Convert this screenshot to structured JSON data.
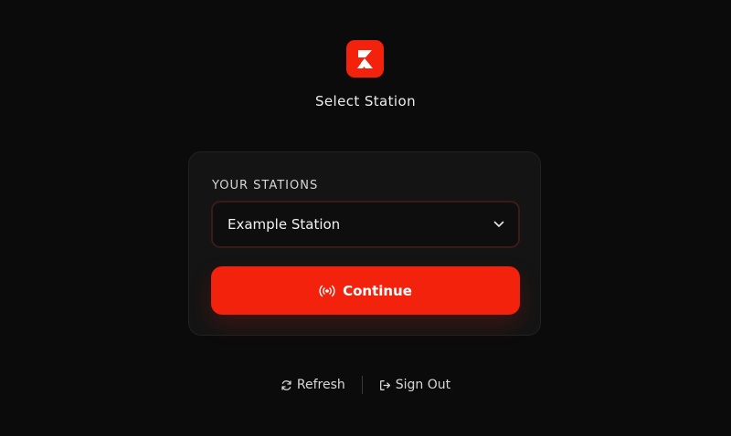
{
  "app": {
    "logo_icon": "brand-logo-icon",
    "brand_color": "#f2220c"
  },
  "header": {
    "title": "Select Station"
  },
  "card": {
    "field_label": "YOUR STATIONS",
    "select": {
      "value": "Example Station",
      "icon": "chevron-down-icon"
    },
    "continue_button": {
      "label": "Continue",
      "icon": "broadcast-icon"
    }
  },
  "footer": {
    "refresh": {
      "label": "Refresh",
      "icon": "refresh-icon"
    },
    "sign_out": {
      "label": "Sign Out",
      "icon": "sign-out-icon"
    }
  }
}
